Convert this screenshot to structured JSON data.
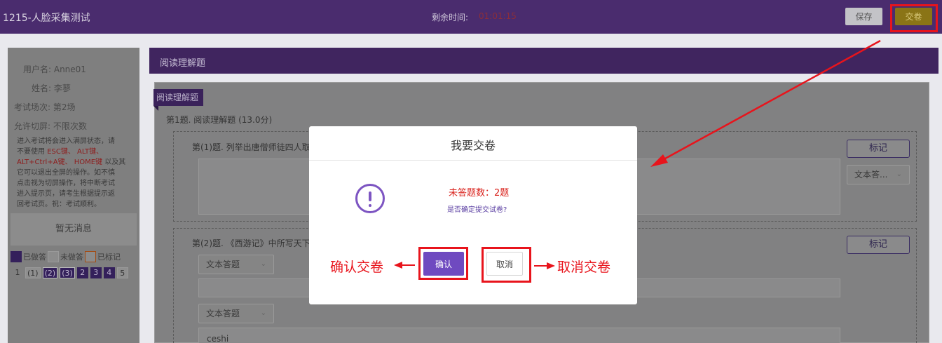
{
  "header": {
    "exam_title": "1215-人脸采集测试",
    "timer_label": "剩余时间:",
    "timer_value": "01:01:15",
    "save_label": "保存",
    "submit_label": "交卷"
  },
  "sidebar": {
    "username": "用户名: Anne01",
    "name": "姓名: 李蓼",
    "session": "考试场次: 第2场",
    "switch_limit": "允许切屏: 不限次数",
    "notice_lines": [
      {
        "text": "进入考试将会进入满屏状态，请"
      },
      {
        "text": "不要使用 ",
        "red": "ESC键、 ALT键、"
      },
      {
        "red": "ALT+Ctrl+A键、 HOME键",
        "text": " 以及其"
      },
      {
        "text": "它可以退出全屏的操作。如不慎"
      },
      {
        "text": "点击视为切屏操作，将中断考试"
      },
      {
        "text": "进入提示页，请考生根据提示返"
      },
      {
        "text": "回考试页。祝：考试顺利。"
      }
    ],
    "message": "暂无消息",
    "legend": {
      "done": "已做答",
      "undone": "未做答",
      "marked": "已标记"
    },
    "nav": [
      "1",
      "(1)",
      "(2)",
      "(3)",
      "2",
      "3",
      "4",
      "5"
    ]
  },
  "main": {
    "section_title": "阅读理解题",
    "section_tag": "阅读理解题",
    "question_heading": "第1题. 阅读理解题 (13.0分)",
    "sub_q1": "第(1)题. 列举出唐僧师徒四人取",
    "sub_q2": "第(2)题. 《西游记》中所写天下",
    "mark_label": "标记",
    "answer_type_short": "文本答...",
    "answer_type": "文本答题",
    "answer_value": "ceshi"
  },
  "modal": {
    "title": "我要交卷",
    "unanswered": "未答题数：2题",
    "question": "是否确定提交试卷?",
    "confirm_label": "确认",
    "cancel_label": "取消"
  },
  "annotations": {
    "confirm": "确认交卷",
    "cancel": "取消交卷"
  },
  "colors": {
    "header_bg": "#4a2c6e",
    "accent": "#6f4ac0",
    "annotation_red": "#e8141c",
    "submit_btn": "#8a7416"
  }
}
